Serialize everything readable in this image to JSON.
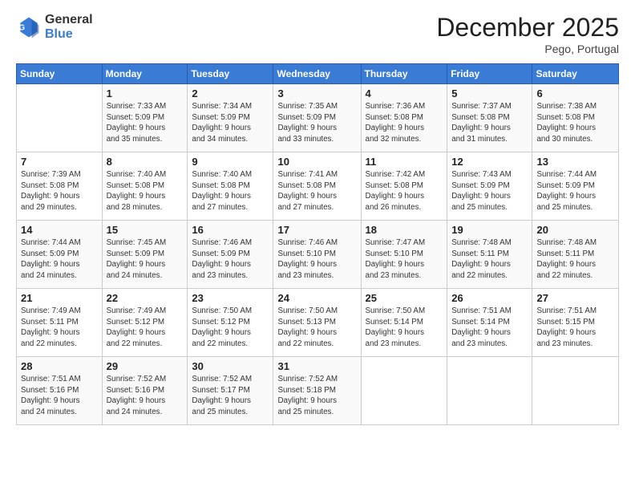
{
  "header": {
    "logo_general": "General",
    "logo_blue": "Blue",
    "month_title": "December 2025",
    "location": "Pego, Portugal"
  },
  "weekdays": [
    "Sunday",
    "Monday",
    "Tuesday",
    "Wednesday",
    "Thursday",
    "Friday",
    "Saturday"
  ],
  "weeks": [
    [
      {
        "day": "",
        "info": ""
      },
      {
        "day": "1",
        "info": "Sunrise: 7:33 AM\nSunset: 5:09 PM\nDaylight: 9 hours\nand 35 minutes."
      },
      {
        "day": "2",
        "info": "Sunrise: 7:34 AM\nSunset: 5:09 PM\nDaylight: 9 hours\nand 34 minutes."
      },
      {
        "day": "3",
        "info": "Sunrise: 7:35 AM\nSunset: 5:09 PM\nDaylight: 9 hours\nand 33 minutes."
      },
      {
        "day": "4",
        "info": "Sunrise: 7:36 AM\nSunset: 5:08 PM\nDaylight: 9 hours\nand 32 minutes."
      },
      {
        "day": "5",
        "info": "Sunrise: 7:37 AM\nSunset: 5:08 PM\nDaylight: 9 hours\nand 31 minutes."
      },
      {
        "day": "6",
        "info": "Sunrise: 7:38 AM\nSunset: 5:08 PM\nDaylight: 9 hours\nand 30 minutes."
      }
    ],
    [
      {
        "day": "7",
        "info": "Sunrise: 7:39 AM\nSunset: 5:08 PM\nDaylight: 9 hours\nand 29 minutes."
      },
      {
        "day": "8",
        "info": "Sunrise: 7:40 AM\nSunset: 5:08 PM\nDaylight: 9 hours\nand 28 minutes."
      },
      {
        "day": "9",
        "info": "Sunrise: 7:40 AM\nSunset: 5:08 PM\nDaylight: 9 hours\nand 27 minutes."
      },
      {
        "day": "10",
        "info": "Sunrise: 7:41 AM\nSunset: 5:08 PM\nDaylight: 9 hours\nand 27 minutes."
      },
      {
        "day": "11",
        "info": "Sunrise: 7:42 AM\nSunset: 5:08 PM\nDaylight: 9 hours\nand 26 minutes."
      },
      {
        "day": "12",
        "info": "Sunrise: 7:43 AM\nSunset: 5:09 PM\nDaylight: 9 hours\nand 25 minutes."
      },
      {
        "day": "13",
        "info": "Sunrise: 7:44 AM\nSunset: 5:09 PM\nDaylight: 9 hours\nand 25 minutes."
      }
    ],
    [
      {
        "day": "14",
        "info": "Sunrise: 7:44 AM\nSunset: 5:09 PM\nDaylight: 9 hours\nand 24 minutes."
      },
      {
        "day": "15",
        "info": "Sunrise: 7:45 AM\nSunset: 5:09 PM\nDaylight: 9 hours\nand 24 minutes."
      },
      {
        "day": "16",
        "info": "Sunrise: 7:46 AM\nSunset: 5:09 PM\nDaylight: 9 hours\nand 23 minutes."
      },
      {
        "day": "17",
        "info": "Sunrise: 7:46 AM\nSunset: 5:10 PM\nDaylight: 9 hours\nand 23 minutes."
      },
      {
        "day": "18",
        "info": "Sunrise: 7:47 AM\nSunset: 5:10 PM\nDaylight: 9 hours\nand 23 minutes."
      },
      {
        "day": "19",
        "info": "Sunrise: 7:48 AM\nSunset: 5:11 PM\nDaylight: 9 hours\nand 22 minutes."
      },
      {
        "day": "20",
        "info": "Sunrise: 7:48 AM\nSunset: 5:11 PM\nDaylight: 9 hours\nand 22 minutes."
      }
    ],
    [
      {
        "day": "21",
        "info": "Sunrise: 7:49 AM\nSunset: 5:11 PM\nDaylight: 9 hours\nand 22 minutes."
      },
      {
        "day": "22",
        "info": "Sunrise: 7:49 AM\nSunset: 5:12 PM\nDaylight: 9 hours\nand 22 minutes."
      },
      {
        "day": "23",
        "info": "Sunrise: 7:50 AM\nSunset: 5:12 PM\nDaylight: 9 hours\nand 22 minutes."
      },
      {
        "day": "24",
        "info": "Sunrise: 7:50 AM\nSunset: 5:13 PM\nDaylight: 9 hours\nand 22 minutes."
      },
      {
        "day": "25",
        "info": "Sunrise: 7:50 AM\nSunset: 5:14 PM\nDaylight: 9 hours\nand 23 minutes."
      },
      {
        "day": "26",
        "info": "Sunrise: 7:51 AM\nSunset: 5:14 PM\nDaylight: 9 hours\nand 23 minutes."
      },
      {
        "day": "27",
        "info": "Sunrise: 7:51 AM\nSunset: 5:15 PM\nDaylight: 9 hours\nand 23 minutes."
      }
    ],
    [
      {
        "day": "28",
        "info": "Sunrise: 7:51 AM\nSunset: 5:16 PM\nDaylight: 9 hours\nand 24 minutes."
      },
      {
        "day": "29",
        "info": "Sunrise: 7:52 AM\nSunset: 5:16 PM\nDaylight: 9 hours\nand 24 minutes."
      },
      {
        "day": "30",
        "info": "Sunrise: 7:52 AM\nSunset: 5:17 PM\nDaylight: 9 hours\nand 25 minutes."
      },
      {
        "day": "31",
        "info": "Sunrise: 7:52 AM\nSunset: 5:18 PM\nDaylight: 9 hours\nand 25 minutes."
      },
      {
        "day": "",
        "info": ""
      },
      {
        "day": "",
        "info": ""
      },
      {
        "day": "",
        "info": ""
      }
    ]
  ]
}
